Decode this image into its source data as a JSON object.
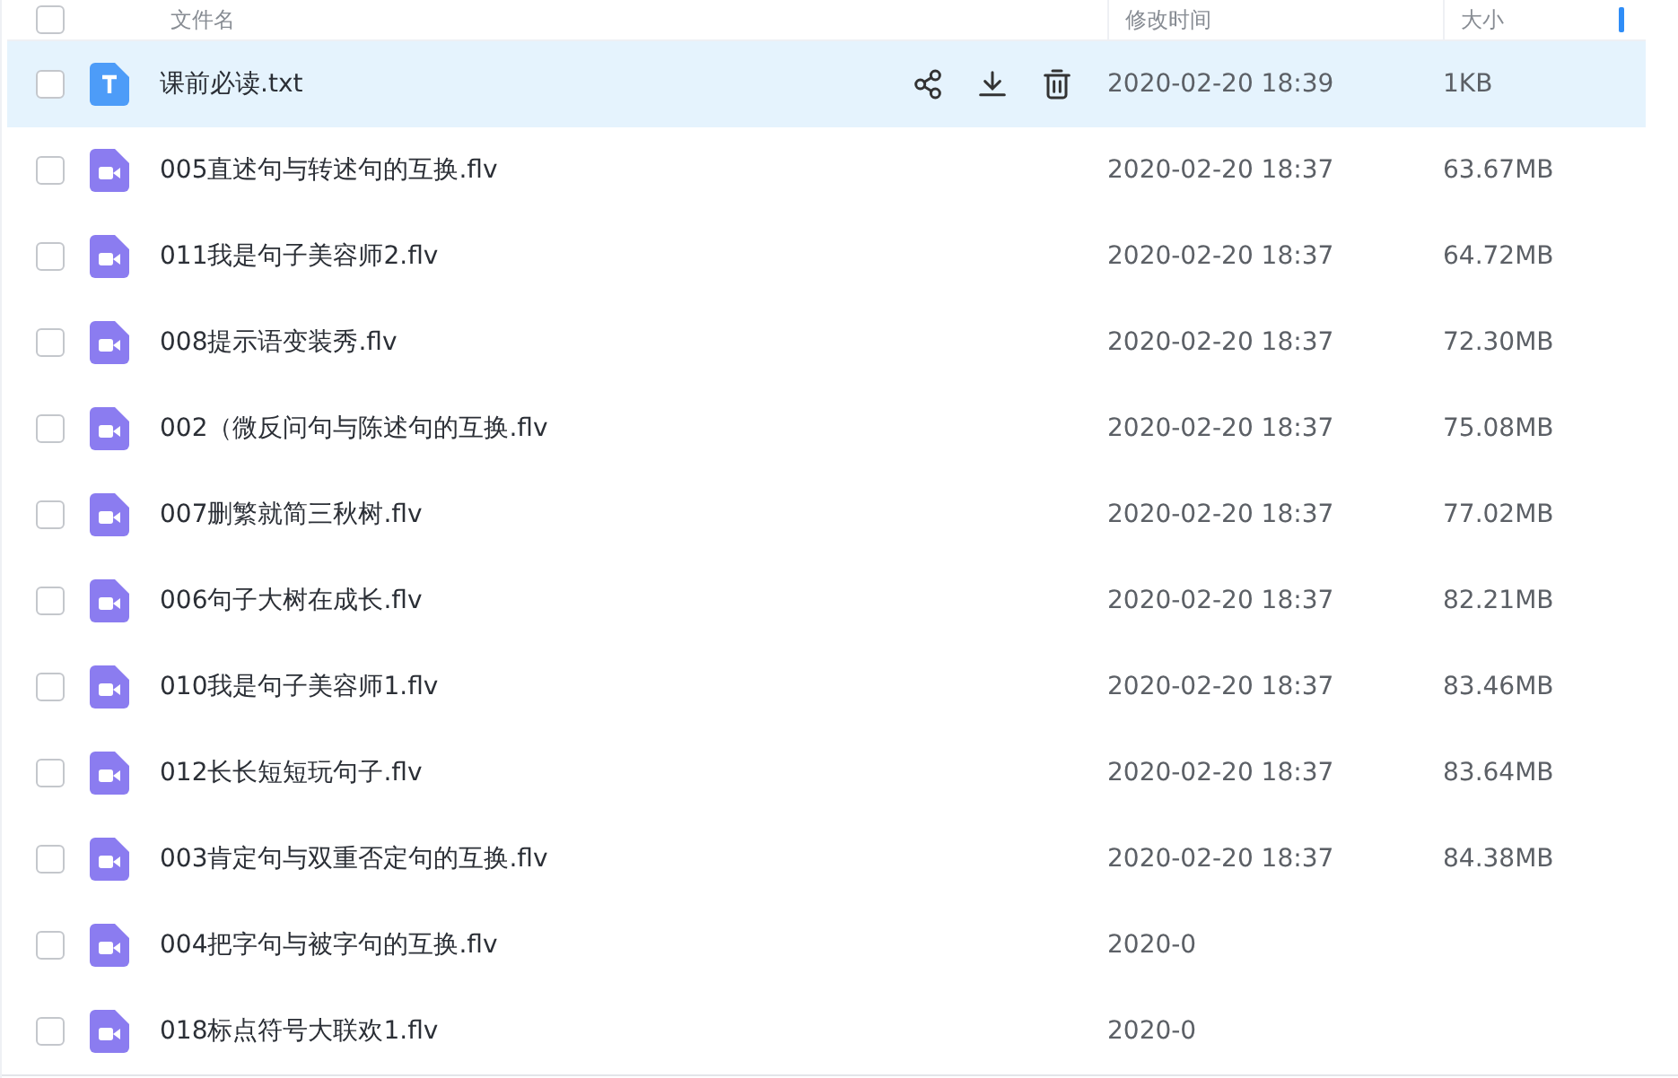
{
  "header": {
    "checked": false,
    "columns": [
      "文件名",
      "修改时间",
      "大小"
    ]
  },
  "files": [
    {
      "kind": "text",
      "name": "课前必读.txt",
      "modified": "2020-02-20 18:39",
      "size": "1KB",
      "selected": true
    },
    {
      "kind": "video",
      "name": "005直述句与转述句的互换.flv",
      "modified": "2020-02-20 18:37",
      "size": "63.67MB",
      "selected": false
    },
    {
      "kind": "video",
      "name": "011我是句子美容师2.flv",
      "modified": "2020-02-20 18:37",
      "size": "64.72MB",
      "selected": false
    },
    {
      "kind": "video",
      "name": "008提示语变装秀.flv",
      "modified": "2020-02-20 18:37",
      "size": "72.30MB",
      "selected": false
    },
    {
      "kind": "video",
      "name": "002（微反问句与陈述句的互换.flv",
      "modified": "2020-02-20 18:37",
      "size": "75.08MB",
      "selected": false
    },
    {
      "kind": "video",
      "name": "007删繁就简三秋树.flv",
      "modified": "2020-02-20 18:37",
      "size": "77.02MB",
      "selected": false
    },
    {
      "kind": "video",
      "name": "006句子大树在成长.flv",
      "modified": "2020-02-20 18:37",
      "size": "82.21MB",
      "selected": false
    },
    {
      "kind": "video",
      "name": "010我是句子美容师1.flv",
      "modified": "2020-02-20 18:37",
      "size": "83.46MB",
      "selected": false
    },
    {
      "kind": "video",
      "name": "012长长短短玩句子.flv",
      "modified": "2020-02-20 18:37",
      "size": "83.64MB",
      "selected": false
    },
    {
      "kind": "video",
      "name": "003肯定句与双重否定句的互换.flv",
      "modified": "2020-02-20 18:37",
      "size": "84.38MB",
      "selected": false
    },
    {
      "kind": "video",
      "name": "004把字句与被字句的互换.flv",
      "modified": "2020-0",
      "selected": false
    },
    {
      "kind": "video",
      "name": "018标点符号大联欢1.flv",
      "modified": "2020-0",
      "selected": false
    }
  ]
}
